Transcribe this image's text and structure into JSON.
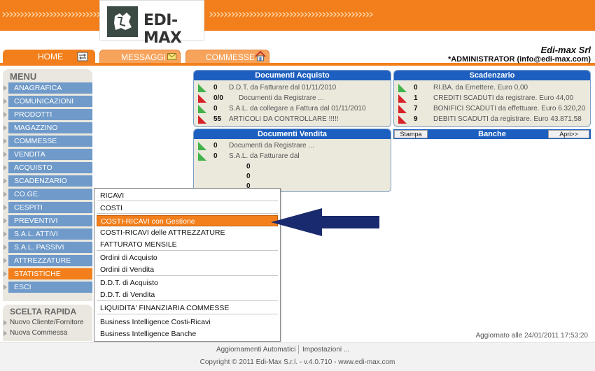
{
  "header": {
    "arrows_text": "›››››››››››››››››››››››››››››››››››››››››››››",
    "logo_text": "EDI-MAX",
    "tabs": [
      {
        "label": "HOME"
      },
      {
        "label": "MESSAGGI"
      },
      {
        "label": "COMMESSE"
      }
    ],
    "company_name": "Edi-max Srl",
    "user": "*ADMINISTRATOR (info@edi-max.com)"
  },
  "menu": {
    "title": "MENU",
    "items": [
      {
        "label": "ANAGRAFICA"
      },
      {
        "label": "COMUNICAZIONI"
      },
      {
        "label": "PRODOTTI"
      },
      {
        "label": "MAGAZZINO"
      },
      {
        "label": "COMMESSE"
      },
      {
        "label": "VENDITA"
      },
      {
        "label": "ACQUISTO"
      },
      {
        "label": "SCADENZARIO"
      },
      {
        "label": "CO.GE."
      },
      {
        "label": "CESPITI"
      },
      {
        "label": "PREVENTIVI"
      },
      {
        "label": "S.A.L. ATTIVI"
      },
      {
        "label": "S.A.L. PASSIVI"
      },
      {
        "label": "ATTREZZATURE"
      },
      {
        "label": "STATISTICHE"
      },
      {
        "label": "ESCI"
      }
    ],
    "active_index": 14
  },
  "quick": {
    "title": "SCELTA RAPIDA",
    "items": [
      {
        "label": "Nuovo Cliente/Fornitore"
      },
      {
        "label": "Nuova Commessa"
      }
    ]
  },
  "doc_acquisto": {
    "title": "Documenti Acquisto",
    "rows": [
      {
        "flag": "green",
        "num": "0",
        "text": "D.D.T. da Fatturare dal 01/11/2010"
      },
      {
        "flag": "red",
        "num": "0/0",
        "text": "Documenti da Registrare ..."
      },
      {
        "flag": "green",
        "num": "0",
        "text": "S.A.L. da collegare a Fattura dal 01/11/2010"
      },
      {
        "flag": "red",
        "num": "55",
        "text": "ARTICOLI DA CONTROLLARE !!!!!"
      }
    ]
  },
  "doc_vendita": {
    "title": "Documenti Vendita",
    "rows": [
      {
        "flag": "green",
        "num": "0",
        "text": "Documenti da Registrare ..."
      },
      {
        "flag": "green",
        "num": "0",
        "text": "S.A.L. da Fatturare dal"
      }
    ],
    "extra_nums": [
      "0",
      "0",
      "0"
    ]
  },
  "scadenzario": {
    "title": "Scadenzario",
    "rows": [
      {
        "flag": "green",
        "num": "0",
        "text": "RI.BA. da Emettere. Euro 0,00"
      },
      {
        "flag": "red",
        "num": "1",
        "text": "CREDITI SCADUTI da registrare. Euro 44,00"
      },
      {
        "flag": "red",
        "num": "7",
        "text": "BONIFICI SCADUTI da effettuare. Euro 6.320,20"
      },
      {
        "flag": "red",
        "num": "9",
        "text": "DEBITI SCADUTI da registrare. Euro 43.871,58"
      }
    ]
  },
  "banche": {
    "title": "Banche",
    "stampa_label": "Stampa",
    "apri_label": "Apri>>"
  },
  "dropdown": {
    "items": [
      {
        "label": "RICAVI"
      },
      {
        "label": "COSTI"
      },
      {
        "label": "COSTI-RICAVI con Gestione"
      },
      {
        "label": "COSTI-RICAVI delle ATTREZZATURE"
      },
      {
        "label": "FATTURATO MENSILE"
      },
      {
        "label": "Ordini di Acquisto"
      },
      {
        "label": "Ordini di Vendita"
      },
      {
        "label": "D.D.T. di Acquisto"
      },
      {
        "label": "D.D.T. di Vendita"
      },
      {
        "label": "LIQUIDITA' FINANZIARIA COMMESSE"
      },
      {
        "label": "Business Intelligence Costi-Ricavi"
      },
      {
        "label": "Business Intelligence Banche"
      }
    ],
    "highlighted_index": 2
  },
  "status": {
    "updated": "Aggiornato alle 24/01/2011 17:53:20"
  },
  "footer": {
    "link_updates": "Aggiornamenti Automatici",
    "link_settings": "Impostazioni ...",
    "copyright": "Copyright © 2011 Edi-Max S.r.l. - v.4.0.710 - www.edi-max.com"
  },
  "colors": {
    "orange": "#f27f1b",
    "menu_blue": "#6f9ac9",
    "panel_header_blue": "#1d5fc0",
    "arrow_navy": "#1a2a6e",
    "flag_green": "#42b34a",
    "flag_red": "#d8222a"
  }
}
